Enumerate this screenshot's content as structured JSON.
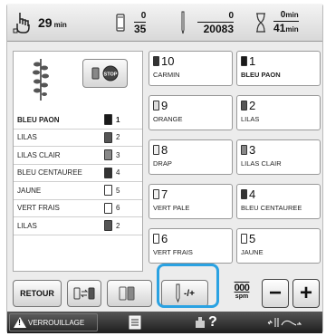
{
  "topbar": {
    "stitch_time": "29",
    "stitch_time_unit": "min",
    "color_current": "0",
    "color_total": "35",
    "stitch_current": "0",
    "stitch_total": "20083",
    "time_current": "0",
    "time_current_unit": "min",
    "time_total": "41",
    "time_total_unit": "min"
  },
  "left_list": [
    {
      "name": "BLEU PAON",
      "num": "1",
      "color": "#1a1a1a",
      "active": true
    },
    {
      "name": "LILAS",
      "num": "2",
      "color": "#555555"
    },
    {
      "name": "LILAS CLAIR",
      "num": "3",
      "color": "#888888"
    },
    {
      "name": "BLEU CENTAUREE",
      "num": "4",
      "color": "#333333"
    },
    {
      "name": "JAUNE",
      "num": "5",
      "color": "#ffffff"
    },
    {
      "name": "VERT FRAIS",
      "num": "6",
      "color": "#ffffff"
    },
    {
      "name": "LILAS",
      "num": "2",
      "color": "#555555"
    }
  ],
  "grid": [
    {
      "num": "10",
      "label": "CARMIN",
      "color": "#333333"
    },
    {
      "num": "1",
      "label": "BLEU PAON",
      "color": "#1a1a1a",
      "bold": true
    },
    {
      "num": "9",
      "label": "ORANGE",
      "color": "#dddddd"
    },
    {
      "num": "2",
      "label": "LILAS",
      "color": "#555555"
    },
    {
      "num": "8",
      "label": "DRAP",
      "color": "#eeeeee"
    },
    {
      "num": "3",
      "label": "LILAS CLAIR",
      "color": "#888888"
    },
    {
      "num": "7",
      "label": "VERT PALE",
      "color": "#f2f2f2"
    },
    {
      "num": "4",
      "label": "BLEU CENTAUREE",
      "color": "#333333"
    },
    {
      "num": "6",
      "label": "VERT FRAIS",
      "color": "#ffffff"
    },
    {
      "num": "5",
      "label": "JAUNE",
      "color": "#ffffff"
    }
  ],
  "controls": {
    "back_label": "RETOUR",
    "stop_label": "STOP",
    "speed_value": "000",
    "speed_unit": "spm",
    "minus": "−",
    "plus": "+"
  },
  "bottom": {
    "lock_label": "VERROUILLAGE",
    "help": "?"
  },
  "colors": {
    "highlight": "#2aa2e2"
  }
}
